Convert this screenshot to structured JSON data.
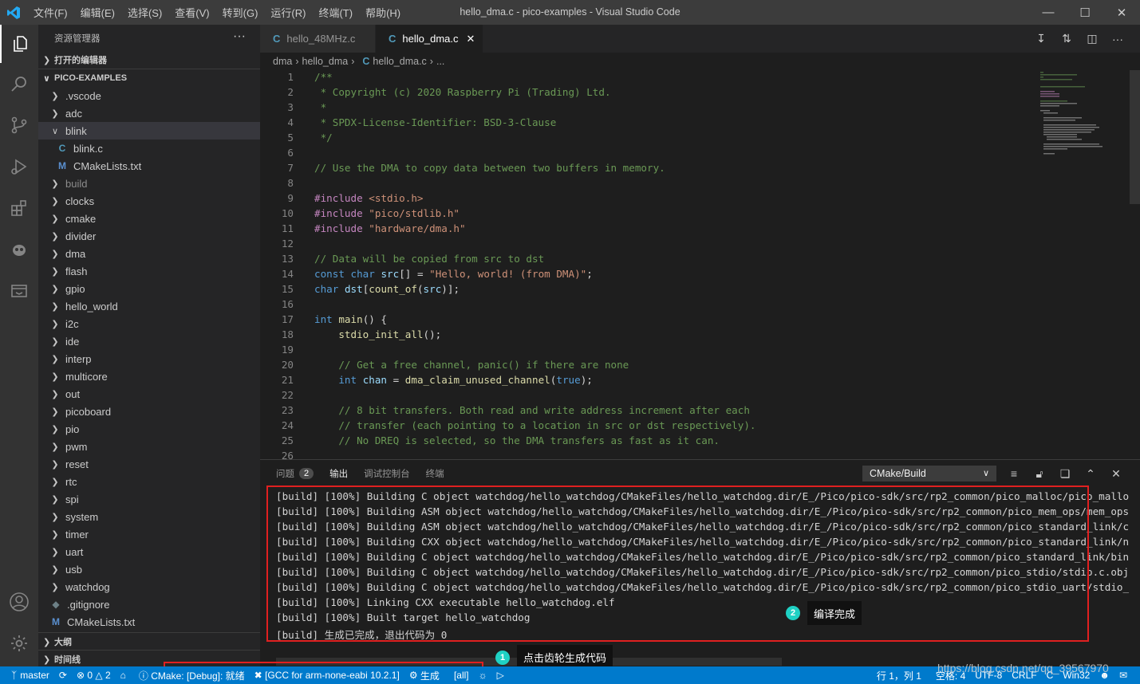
{
  "app": {
    "window_title": "hello_dma.c - pico-examples - Visual Studio Code",
    "menu": [
      "文件(F)",
      "编辑(E)",
      "选择(S)",
      "查看(V)",
      "转到(G)",
      "运行(R)",
      "终端(T)",
      "帮助(H)"
    ]
  },
  "sidebar": {
    "title": "资源管理器",
    "open_editors": "打开的编辑器",
    "folder": "PICO-EXAMPLES",
    "items": [
      {
        "label": ".vscode",
        "kind": "folder"
      },
      {
        "label": "adc",
        "kind": "folder"
      },
      {
        "label": "blink",
        "kind": "folder-open"
      },
      {
        "label": "blink.c",
        "kind": "c-file"
      },
      {
        "label": "CMakeLists.txt",
        "kind": "cmake-file"
      },
      {
        "label": "build",
        "kind": "folder"
      },
      {
        "label": "clocks",
        "kind": "folder"
      },
      {
        "label": "cmake",
        "kind": "folder"
      },
      {
        "label": "divider",
        "kind": "folder"
      },
      {
        "label": "dma",
        "kind": "folder"
      },
      {
        "label": "flash",
        "kind": "folder"
      },
      {
        "label": "gpio",
        "kind": "folder"
      },
      {
        "label": "hello_world",
        "kind": "folder"
      },
      {
        "label": "i2c",
        "kind": "folder"
      },
      {
        "label": "ide",
        "kind": "folder"
      },
      {
        "label": "interp",
        "kind": "folder"
      },
      {
        "label": "multicore",
        "kind": "folder"
      },
      {
        "label": "out",
        "kind": "folder"
      },
      {
        "label": "picoboard",
        "kind": "folder"
      },
      {
        "label": "pio",
        "kind": "folder"
      },
      {
        "label": "pwm",
        "kind": "folder"
      },
      {
        "label": "reset",
        "kind": "folder"
      },
      {
        "label": "rtc",
        "kind": "folder"
      },
      {
        "label": "spi",
        "kind": "folder"
      },
      {
        "label": "system",
        "kind": "folder"
      },
      {
        "label": "timer",
        "kind": "folder"
      },
      {
        "label": "uart",
        "kind": "folder"
      },
      {
        "label": "usb",
        "kind": "folder"
      },
      {
        "label": "watchdog",
        "kind": "folder"
      },
      {
        "label": ".gitignore",
        "kind": "git-file"
      },
      {
        "label": "CMakeLists.txt",
        "kind": "cmake-file"
      }
    ],
    "outline": "大纲",
    "timeline": "时间线"
  },
  "tabs": [
    {
      "label": "hello_48MHz.c",
      "active": false
    },
    {
      "label": "hello_dma.c",
      "active": true
    }
  ],
  "breadcrumb": {
    "p1": "dma",
    "p2": "hello_dma",
    "p3": "hello_dma.c",
    "p4": "..."
  },
  "editor": {
    "lines": [
      "/**",
      " * Copyright (c) 2020 Raspberry Pi (Trading) Ltd.",
      " *",
      " * SPDX-License-Identifier: BSD-3-Clause",
      " */",
      "",
      "// Use the DMA to copy data between two buffers in memory.",
      "",
      "#include <stdio.h>",
      "#include \"pico/stdlib.h\"",
      "#include \"hardware/dma.h\"",
      "",
      "// Data will be copied from src to dst",
      "const char src[] = \"Hello, world! (from DMA)\";",
      "char dst[count_of(src)];",
      "",
      "int main() {",
      "    stdio_init_all();",
      "",
      "    // Get a free channel, panic() if there are none",
      "    int chan = dma_claim_unused_channel(true);",
      "",
      "    // 8 bit transfers. Both read and write address increment after each",
      "    // transfer (each pointing to a location in src or dst respectively).",
      "    // No DREQ is selected, so the DMA transfers as fast as it can.",
      ""
    ]
  },
  "panel": {
    "tabs": [
      {
        "label": "问题",
        "badge": "2"
      },
      {
        "label": "输出"
      },
      {
        "label": "调试控制台"
      },
      {
        "label": "终端"
      }
    ],
    "output_channel": "CMake/Build",
    "output_lines": [
      "[build] [100%] Building C object watchdog/hello_watchdog/CMakeFiles/hello_watchdog.dir/E_/Pico/pico-sdk/src/rp2_common/pico_malloc/pico_mallo",
      "[build] [100%] Building ASM object watchdog/hello_watchdog/CMakeFiles/hello_watchdog.dir/E_/Pico/pico-sdk/src/rp2_common/pico_mem_ops/mem_ops",
      "[build] [100%] Building ASM object watchdog/hello_watchdog/CMakeFiles/hello_watchdog.dir/E_/Pico/pico-sdk/src/rp2_common/pico_standard_link/c",
      "[build] [100%] Building CXX object watchdog/hello_watchdog/CMakeFiles/hello_watchdog.dir/E_/Pico/pico-sdk/src/rp2_common/pico_standard_link/n",
      "[build] [100%] Building C object watchdog/hello_watchdog/CMakeFiles/hello_watchdog.dir/E_/Pico/pico-sdk/src/rp2_common/pico_standard_link/bin",
      "[build] [100%] Building C object watchdog/hello_watchdog/CMakeFiles/hello_watchdog.dir/E_/Pico/pico-sdk/src/rp2_common/pico_stdio/stdio.c.obj",
      "[build] [100%] Building C object watchdog/hello_watchdog/CMakeFiles/hello_watchdog.dir/E_/Pico/pico-sdk/src/rp2_common/pico_stdio_uart/stdio_",
      "[build] [100%] Linking CXX executable hello_watchdog.elf",
      "[build] [100%] Built target hello_watchdog",
      "[build] 生成已完成，退出代码为 0"
    ]
  },
  "annotations": {
    "callout1": {
      "num": "1",
      "label": "点击齿轮生成代码"
    },
    "callout2": {
      "num": "2",
      "label": "编译完成"
    }
  },
  "statusbar": {
    "branch": "master",
    "errors": "0",
    "warnings": "2",
    "cmake": "CMake: [Debug]: 就绪",
    "kit": "[GCC for arm-none-eabi 10.2.1]",
    "build": "生成",
    "target": "[all]",
    "position": "行 1，列 1",
    "spaces": "空格: 4",
    "encoding": "UTF-8",
    "eol": "CRLF",
    "language": "C",
    "platform": "Win32"
  },
  "watermark": "https://blog.csdn.net/qq_39567970",
  "colors": {
    "statusbar": "#007acc",
    "highlight_box": "#e02020",
    "callout": "#1fd1c4"
  }
}
